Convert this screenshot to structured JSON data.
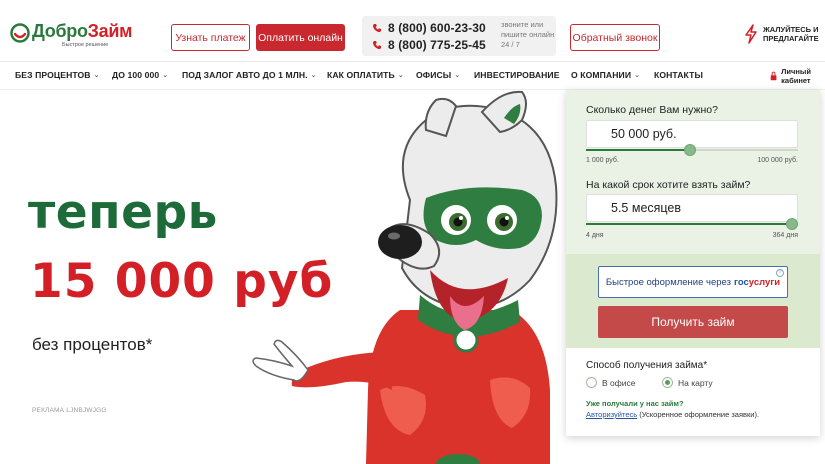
{
  "header": {
    "logo": {
      "part1": "Добро",
      "part2": "Займ",
      "tagline": "Быстрое решение"
    },
    "learn_payment": "Узнать платеж",
    "pay_online": "Оплатить онлайн",
    "phones": [
      "8 (800) 600-23-30",
      "8 (800) 775-25-45"
    ],
    "call_note": "звоните или пишите онлайн 24 / 7",
    "callback": "Обратный звонок",
    "complain": "ЖАЛУЙТЕСЬ И ПРЕДЛАГАЙТЕ",
    "cabinet": "Личный кабинет"
  },
  "nav": {
    "items": [
      {
        "label": "БЕЗ ПРОЦЕНТОВ",
        "dropdown": true
      },
      {
        "label": "ДО 100 000",
        "dropdown": true
      },
      {
        "label": "ПОД ЗАЛОГ АВТО ДО 1 МЛН.",
        "dropdown": true
      },
      {
        "label": "КАК ОПЛАТИТЬ",
        "dropdown": true
      },
      {
        "label": "ОФИСЫ",
        "dropdown": true
      },
      {
        "label": "ИНВЕСТИРОВАНИЕ",
        "dropdown": false
      },
      {
        "label": "О КОМПАНИИ",
        "dropdown": true
      },
      {
        "label": "КОНТАКТЫ",
        "dropdown": false
      }
    ]
  },
  "hero": {
    "line1": "теперь",
    "line2": "15 000 руб",
    "line3": "без процентов*",
    "ad_label": "РЕКЛАМА LJNBJWJGG"
  },
  "calculator": {
    "amount_question": "Сколько денег Вам нужно?",
    "amount_value": "50 000 руб.",
    "amount_min": "1 000 руб.",
    "amount_max": "100 000 руб.",
    "amount_fraction": 0.49,
    "term_question": "На какой срок хотите взять займ?",
    "term_value": "5.5 месяцев",
    "term_min": "4 дня",
    "term_max": "364 дня",
    "term_fraction": 1.0,
    "gosuslugi_prefix": "Быстрое оформление через",
    "gosuslugi_word_a": "гос",
    "gosuslugi_word_b": "услуги",
    "get_loan": "Получить займ",
    "method_label": "Способ получения займа*",
    "method_options": [
      {
        "label": "В офисе",
        "selected": false
      },
      {
        "label": "На карту",
        "selected": true
      }
    ],
    "already_label": "Уже получали у нас займ?",
    "auth_link": "Авторизуйтесь",
    "auth_note": "(Ускоренное оформление заявки)."
  },
  "colors": {
    "brand_green": "#2a7a3b",
    "brand_red": "#d32027",
    "button_red": "#c8282e",
    "panel_green": "#e9f2e4"
  },
  "icons": [
    "logo-smile-icon",
    "phone-icon",
    "lightning-icon",
    "chevron-down-icon",
    "user-lock-icon",
    "question-icon"
  ]
}
